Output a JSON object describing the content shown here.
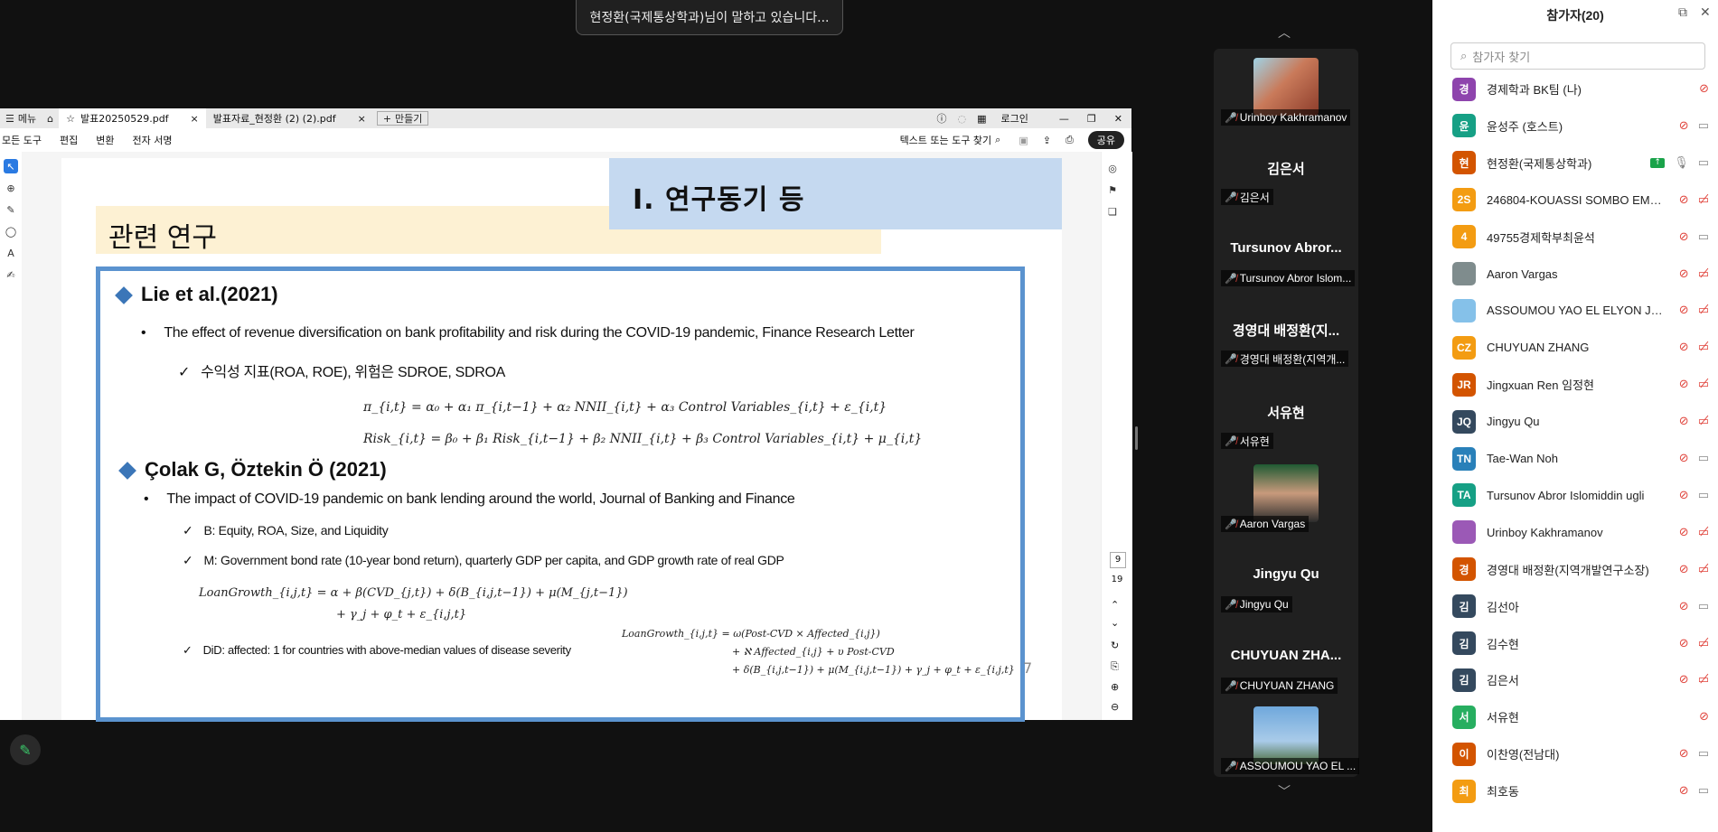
{
  "speaking_banner": "현정환(국제통상학과)님이 말하고 있습니다...",
  "window": {
    "menu_label": "메뉴",
    "tabs": [
      {
        "label": "발표20250529.pdf",
        "active": true
      },
      {
        "label": "발표자료_현정환 (2) (2).pdf",
        "active": false
      }
    ],
    "new_tab": "만들기",
    "login": "로그인",
    "toolbar": [
      "모든 도구",
      "편집",
      "변환",
      "전자 서명"
    ],
    "search_placeholder": "텍스트 또는 도구 찾기",
    "share_btn": "공유",
    "page_current": "9",
    "page_total": "19"
  },
  "slide": {
    "section_title": "Ⅰ. 연구동기 등",
    "heading": "관련 연구",
    "ref1_title": "Lie et al.(2021)",
    "ref1_bullet": "The effect of revenue diversification on bank profitability and risk during the COVID-19 pandemic, Finance Research Letter",
    "ref1_check": "수익성 지표(ROA, ROE), 위험은 SDROE, SDROA",
    "eq1": "π_{i,t} = α₀ + α₁ π_{i,t−1} + α₂ NNII_{i,t} + α₃ Control Variables_{i,t} + ε_{i,t}",
    "eq2": "Risk_{i,t} = β₀ + β₁ Risk_{i,t−1} + β₂ NNII_{i,t} + β₃ Control Variables_{i,t} + μ_{i,t}",
    "ref2_title": "Çolak G, Öztekin Ö (2021)",
    "ref2_bullet": "The impact of COVID-19 pandemic on bank lending around the world, Journal of Banking and Finance",
    "ref2_check_b": "B: Equity, ROA, Size, and Liquidity",
    "ref2_check_m": "M: Government bond rate (10-year bond return), quarterly GDP per capita, and GDP growth rate of real GDP",
    "eq3a": "LoanGrowth_{i,j,t} = α + β(CVD_{j,t}) + δ(B_{i,j,t−1}) + μ(M_{j,t−1})",
    "eq3b": "+ γ_j + φ_t + ε_{i,j,t}",
    "ref2_check_did": "DiD: affected: 1 for countries with above-median values of disease severity",
    "eq4a": "LoanGrowth_{i,j,t} = ω(Post-CVD × Affected_{i,j})",
    "eq4b": "+ ℵ Affected_{i,j} + υ Post-CVD",
    "eq4c": "+ δ(B_{i,j,t−1}) + μ(M_{i,j,t−1}) + γ_j + φ_t + ε_{i,j,t}",
    "page_number": "7"
  },
  "video_panel": [
    {
      "type": "thumb",
      "label": "Urinboy Kakhramanov"
    },
    {
      "type": "name",
      "name": "김은서",
      "label": "김은서"
    },
    {
      "type": "name",
      "name": "Tursunov Abror...",
      "label": "Tursunov Abror Islom..."
    },
    {
      "type": "name",
      "name": "경영대 배정환(지...",
      "label": "경영대 배정환(지역개..."
    },
    {
      "type": "name",
      "name": "서유현",
      "label": "서유현"
    },
    {
      "type": "thumb",
      "label": "Aaron Vargas"
    },
    {
      "type": "name",
      "name": "Jingyu Qu",
      "label": "Jingyu Qu"
    },
    {
      "type": "name",
      "name": "CHUYUAN ZHA...",
      "label": "CHUYUAN ZHANG"
    },
    {
      "type": "thumb",
      "label": "ASSOUMOU YAO EL ..."
    }
  ],
  "participants": {
    "title": "참가자(20)",
    "search_placeholder": "참가자 찾기",
    "list": [
      {
        "initial": "경",
        "color": "#8e44ad",
        "name": "경제학과 BK팀 (나)",
        "cam": false
      },
      {
        "initial": "윤",
        "color": "#16a085",
        "name": "윤성주 (호스트)",
        "cam": true
      },
      {
        "initial": "현",
        "color": "#d35400",
        "name": "현정환(국제통상학과)",
        "cam": true
      },
      {
        "initial": "2S",
        "color": "#f39c12",
        "name": "246804-KOUASSI SOMBO EMMA...",
        "cam": false
      },
      {
        "initial": "4",
        "color": "#f39c12",
        "name": "49755경제학부최윤석",
        "cam": true
      },
      {
        "initial": "",
        "color": "#7f8c8d",
        "name": "Aaron Vargas",
        "cam": false
      },
      {
        "initial": "",
        "color": "#85c1e9",
        "name": "ASSOUMOU YAO EL ELYON JEA...",
        "cam": false
      },
      {
        "initial": "CZ",
        "color": "#f39c12",
        "name": "CHUYUAN ZHANG",
        "cam": false
      },
      {
        "initial": "JR",
        "color": "#d35400",
        "name": "Jingxuan Ren 임정현",
        "cam": false
      },
      {
        "initial": "JQ",
        "color": "#34495e",
        "name": "Jingyu Qu",
        "cam": false
      },
      {
        "initial": "TN",
        "color": "#2980b9",
        "name": "Tae-Wan Noh",
        "cam": true
      },
      {
        "initial": "TA",
        "color": "#16a085",
        "name": "Tursunov Abror Islomiddin ugli",
        "cam": true
      },
      {
        "initial": "",
        "color": "#9b59b6",
        "name": "Urinboy Kakhramanov",
        "cam": false
      },
      {
        "initial": "경",
        "color": "#d35400",
        "name": "경영대 배정환(지역개발연구소장)",
        "cam": false
      },
      {
        "initial": "김",
        "color": "#34495e",
        "name": "김선아",
        "cam": true
      },
      {
        "initial": "김",
        "color": "#34495e",
        "name": "김수현",
        "cam": false
      },
      {
        "initial": "김",
        "color": "#34495e",
        "name": "김은서",
        "cam": false
      },
      {
        "initial": "서",
        "color": "#27ae60",
        "name": "서유현",
        "cam": false
      },
      {
        "initial": "이",
        "color": "#d35400",
        "name": "이찬영(전남대)",
        "cam": true
      },
      {
        "initial": "최",
        "color": "#f39c12",
        "name": "최호동",
        "cam": true
      }
    ]
  }
}
